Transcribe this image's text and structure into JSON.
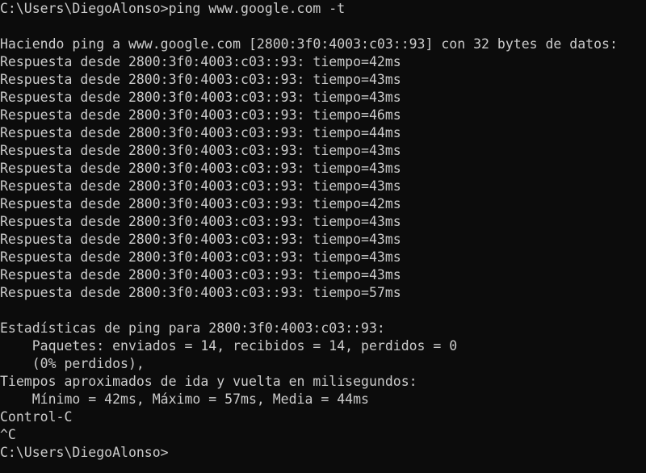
{
  "terminal": {
    "lines": [
      "C:\\Users\\DiegoAlonso>ping www.google.com -t",
      "",
      "Haciendo ping a www.google.com [2800:3f0:4003:c03::93] con 32 bytes de datos:",
      "Respuesta desde 2800:3f0:4003:c03::93: tiempo=42ms",
      "Respuesta desde 2800:3f0:4003:c03::93: tiempo=43ms",
      "Respuesta desde 2800:3f0:4003:c03::93: tiempo=43ms",
      "Respuesta desde 2800:3f0:4003:c03::93: tiempo=46ms",
      "Respuesta desde 2800:3f0:4003:c03::93: tiempo=44ms",
      "Respuesta desde 2800:3f0:4003:c03::93: tiempo=43ms",
      "Respuesta desde 2800:3f0:4003:c03::93: tiempo=43ms",
      "Respuesta desde 2800:3f0:4003:c03::93: tiempo=43ms",
      "Respuesta desde 2800:3f0:4003:c03::93: tiempo=42ms",
      "Respuesta desde 2800:3f0:4003:c03::93: tiempo=43ms",
      "Respuesta desde 2800:3f0:4003:c03::93: tiempo=43ms",
      "Respuesta desde 2800:3f0:4003:c03::93: tiempo=43ms",
      "Respuesta desde 2800:3f0:4003:c03::93: tiempo=43ms",
      "Respuesta desde 2800:3f0:4003:c03::93: tiempo=57ms",
      "",
      "Estadísticas de ping para 2800:3f0:4003:c03::93:",
      "    Paquetes: enviados = 14, recibidos = 14, perdidos = 0",
      "    (0% perdidos),",
      "Tiempos aproximados de ida y vuelta en milisegundos:",
      "    Mínimo = 42ms, Máximo = 57ms, Media = 44ms",
      "Control-C",
      "^C",
      "C:\\Users\\DiegoAlonso>"
    ]
  },
  "colors": {
    "background": "#0c0c0c",
    "foreground": "#cccccc"
  }
}
